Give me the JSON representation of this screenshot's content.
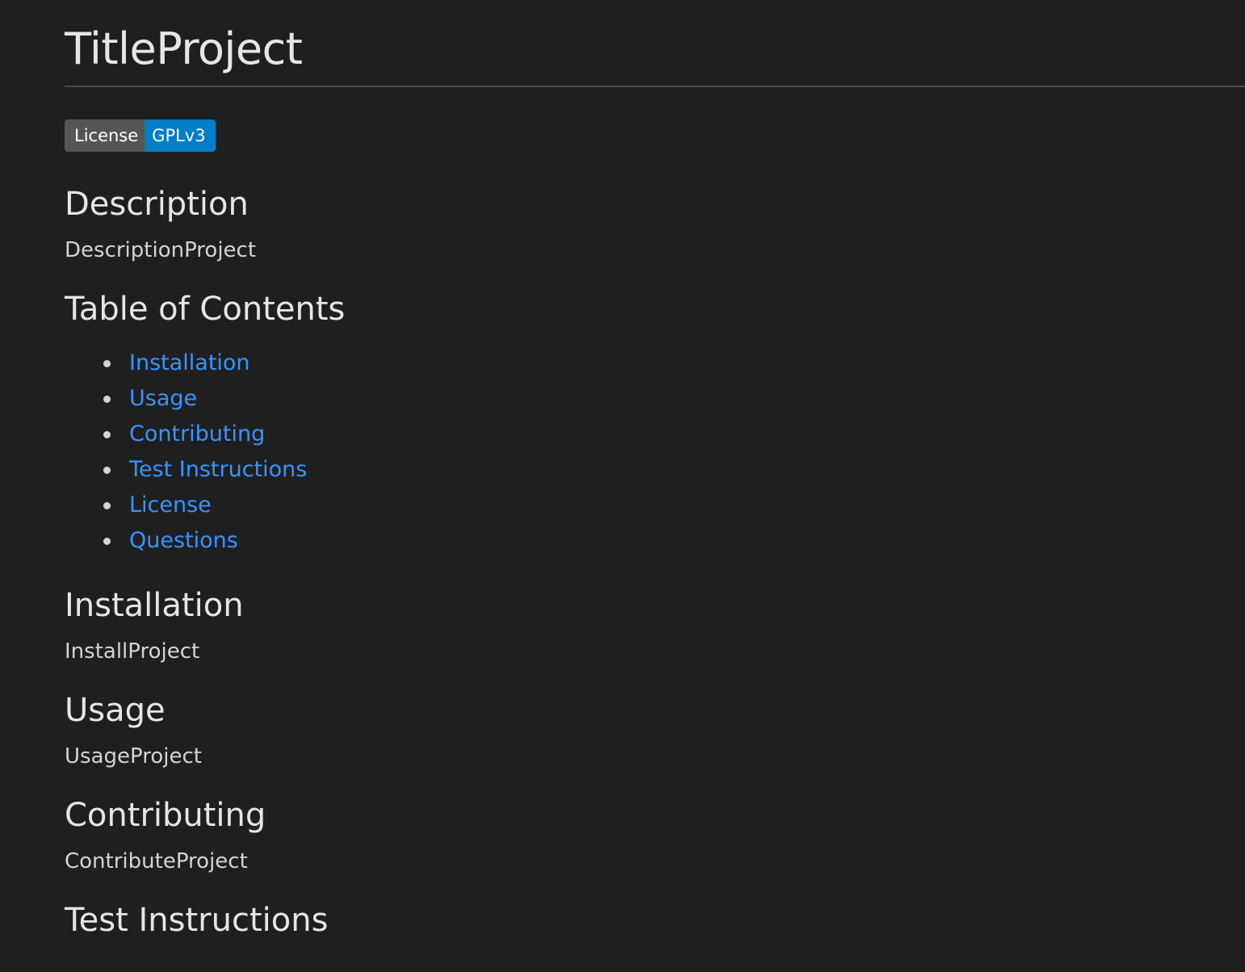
{
  "title": "TitleProject",
  "badge": {
    "left": "License",
    "right": "GPLv3",
    "left_color": "#555555",
    "right_color": "#007ec6"
  },
  "sections": {
    "description": {
      "heading": "Description",
      "body": "DescriptionProject"
    },
    "toc": {
      "heading": "Table of Contents",
      "items": [
        "Installation",
        "Usage",
        "Contributing",
        "Test Instructions",
        "License",
        "Questions"
      ]
    },
    "installation": {
      "heading": "Installation",
      "body": "InstallProject"
    },
    "usage": {
      "heading": "Usage",
      "body": "UsageProject"
    },
    "contributing": {
      "heading": "Contributing",
      "body": "ContributeProject"
    },
    "test": {
      "heading": "Test Instructions"
    }
  },
  "colors": {
    "background": "#1f1f1f",
    "text": "#d4d4d4",
    "link": "#3794ff",
    "rule": "#4a4a4a"
  }
}
